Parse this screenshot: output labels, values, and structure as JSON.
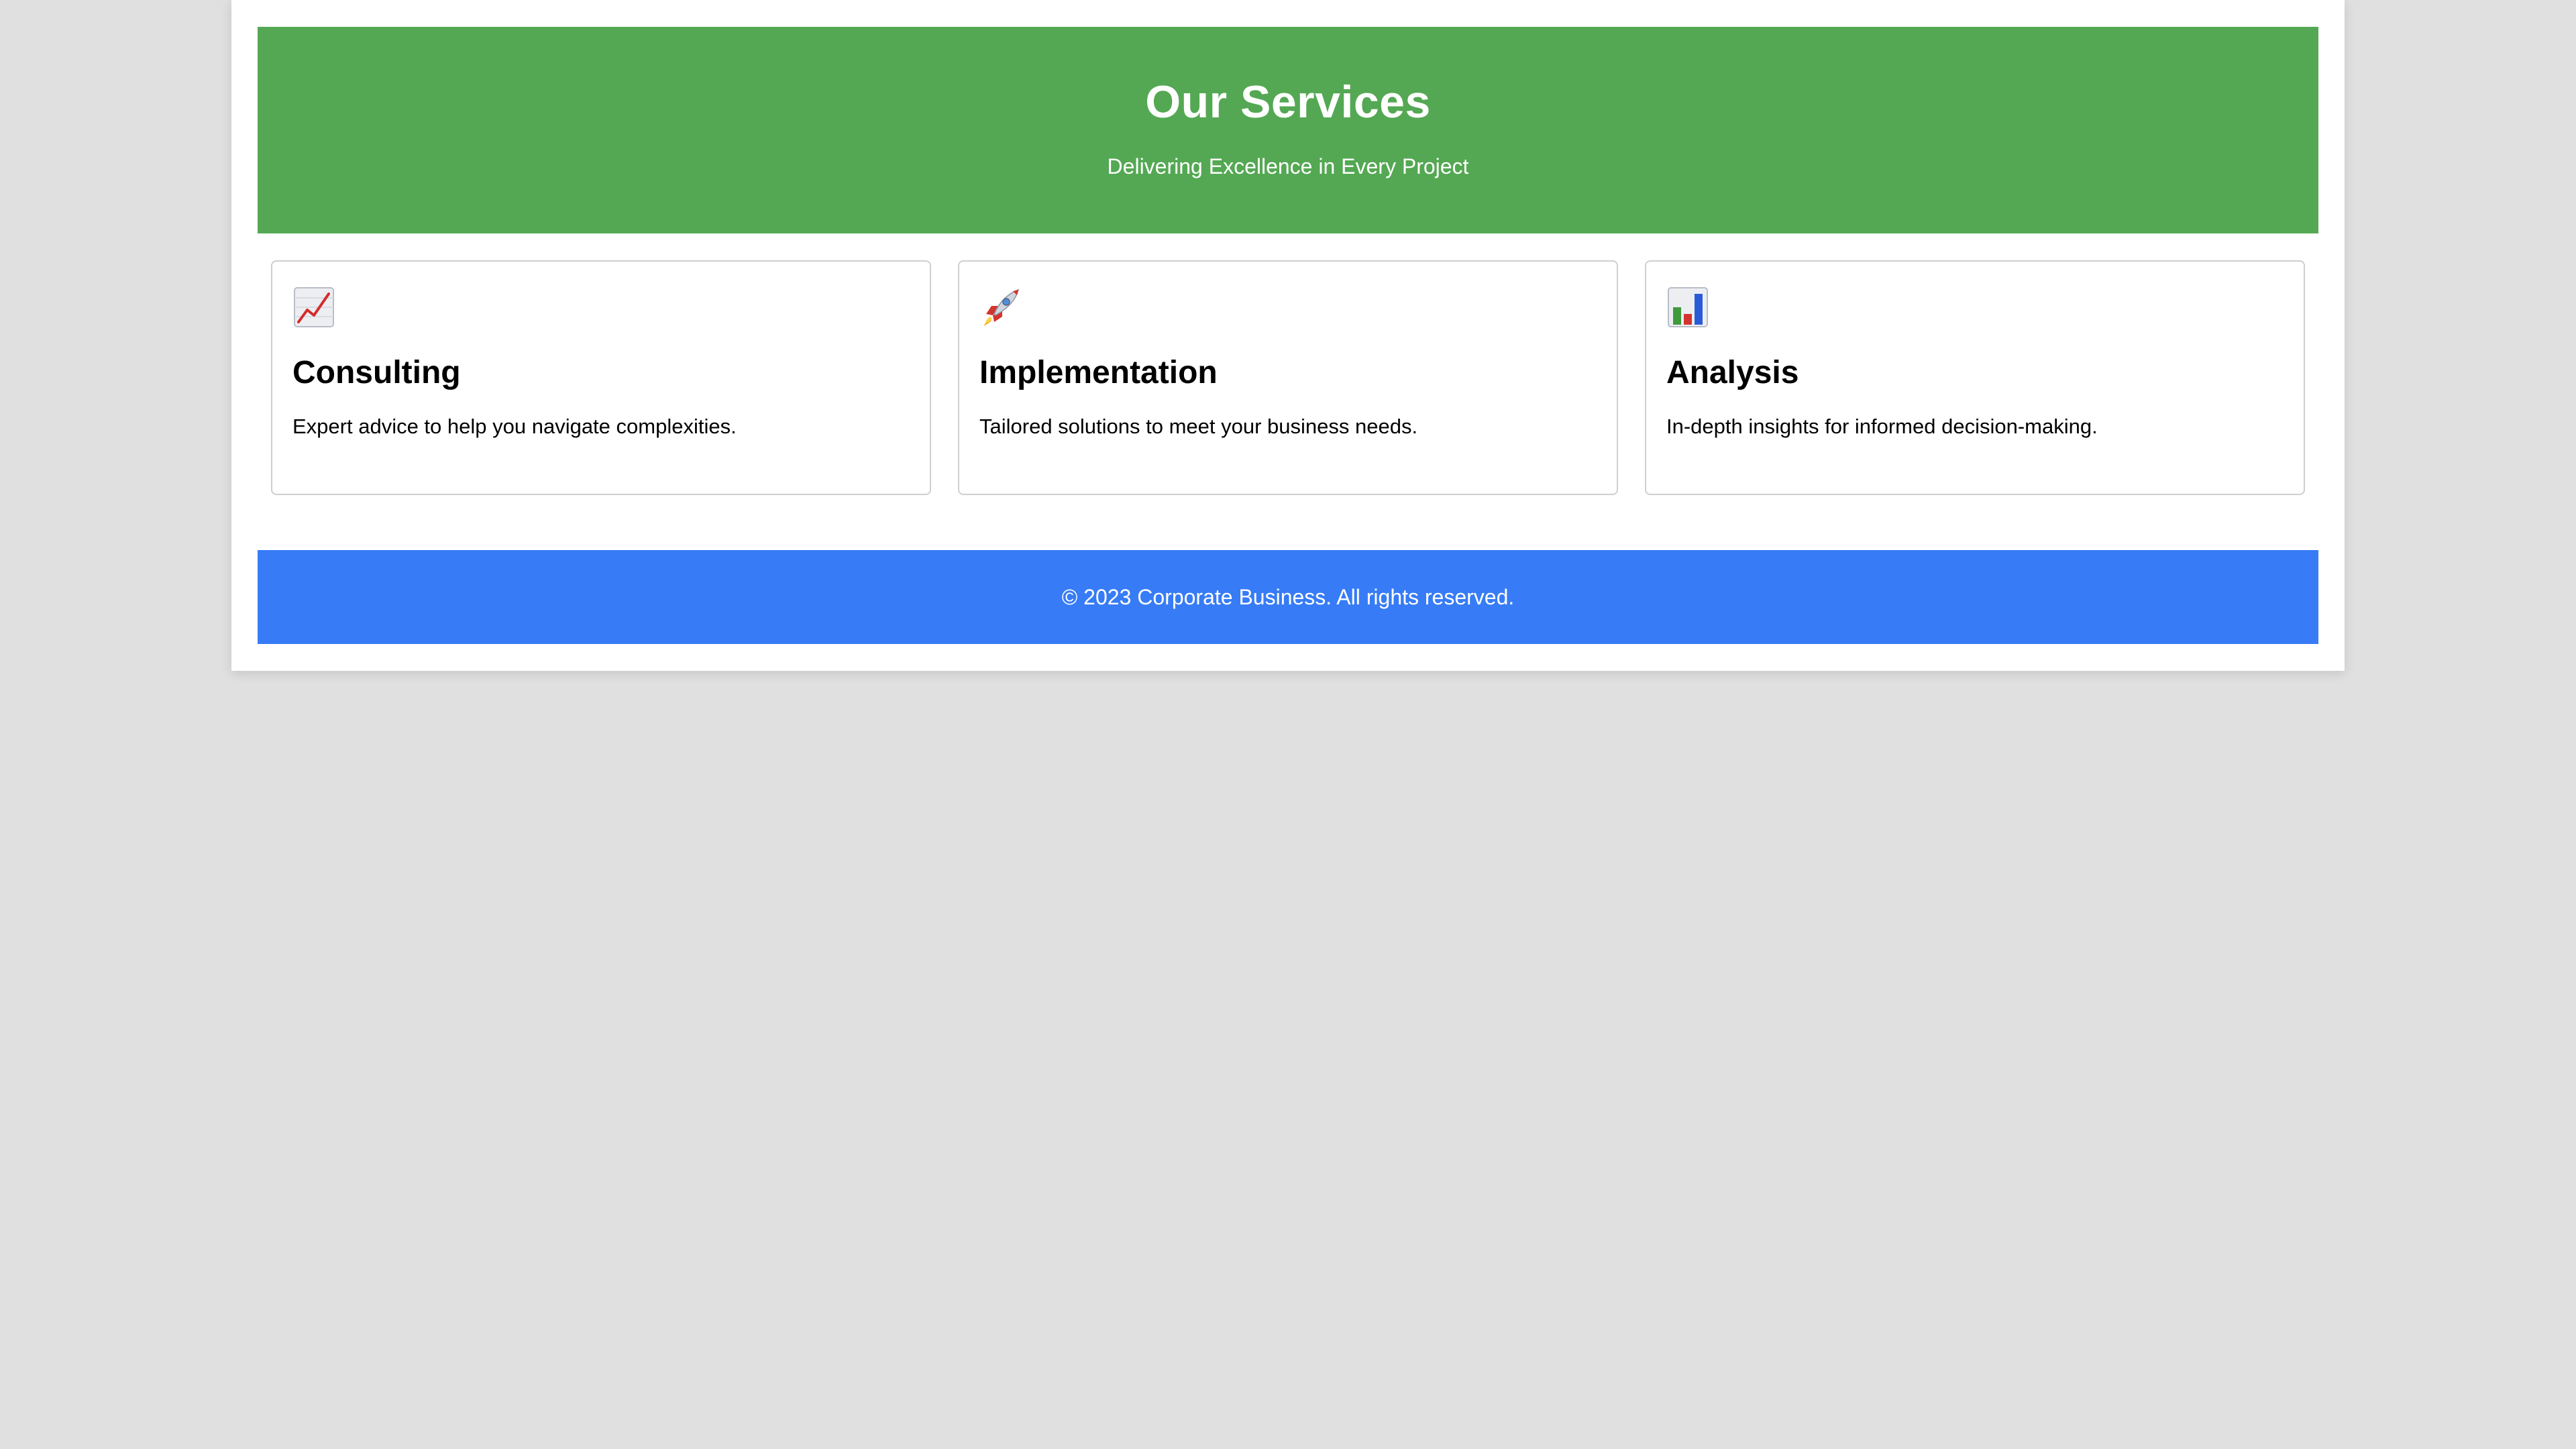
{
  "header": {
    "title": "Our Services",
    "subtitle": "Delivering Excellence in Every Project",
    "background_color": "#54a853"
  },
  "services": [
    {
      "icon": "chart-increasing-icon",
      "title": "Consulting",
      "description": "Expert advice to help you navigate complexities."
    },
    {
      "icon": "rocket-icon",
      "title": "Implementation",
      "description": "Tailored solutions to meet your business needs."
    },
    {
      "icon": "bar-chart-icon",
      "title": "Analysis",
      "description": "In-depth insights for informed decision-making."
    }
  ],
  "footer": {
    "text": "© 2023 Corporate Business. All rights reserved.",
    "background_color": "#377cf6"
  },
  "colors": {
    "page_background": "#e0e0e0",
    "container_background": "#ffffff",
    "card_border": "#cfcfcf"
  }
}
